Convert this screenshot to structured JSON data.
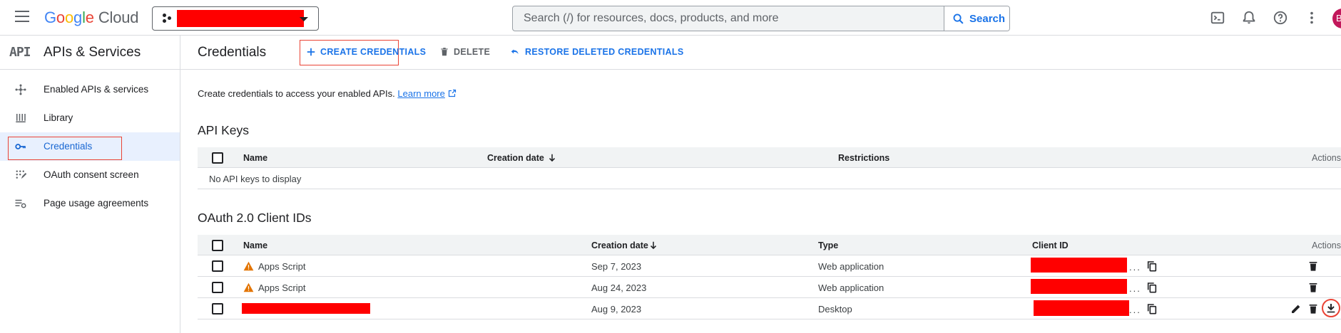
{
  "header": {
    "logo_google": "Google",
    "logo_cloud": "Cloud",
    "search_placeholder": "Search (/) for resources, docs, products, and more",
    "search_button": "Search",
    "avatar_letter": "B"
  },
  "sidebar": {
    "title": "APIs & Services",
    "logo_text": "API",
    "items": [
      {
        "label": "Enabled APIs & services",
        "icon": "hub-icon"
      },
      {
        "label": "Library",
        "icon": "library-icon"
      },
      {
        "label": "Credentials",
        "icon": "key-icon",
        "active": true
      },
      {
        "label": "OAuth consent screen",
        "icon": "consent-icon"
      },
      {
        "label": "Page usage agreements",
        "icon": "settings-list-icon"
      }
    ]
  },
  "main": {
    "title": "Credentials",
    "actions": {
      "create": "CREATE CREDENTIALS",
      "delete": "DELETE",
      "restore": "RESTORE DELETED CREDENTIALS"
    },
    "intro_text": "Create credentials to access your enabled APIs.",
    "learn_more": "Learn more",
    "api_keys": {
      "title": "API Keys",
      "columns": {
        "name": "Name",
        "creation_date": "Creation date",
        "restrictions": "Restrictions",
        "actions": "Actions"
      },
      "empty": "No API keys to display"
    },
    "oauth": {
      "title": "OAuth 2.0 Client IDs",
      "columns": {
        "name": "Name",
        "creation_date": "Creation date",
        "type": "Type",
        "client_id": "Client ID",
        "actions": "Actions"
      },
      "rows": [
        {
          "name": "Apps Script",
          "warning": true,
          "date": "Sep 7, 2023",
          "type": "Web application",
          "client_suffix": "..."
        },
        {
          "name": "Apps Script",
          "warning": true,
          "date": "Aug 24, 2023",
          "type": "Web application",
          "client_suffix": "..."
        },
        {
          "name": "",
          "redacted": true,
          "date": "Aug 9, 2023",
          "type": "Desktop",
          "client_suffix": "..."
        }
      ]
    }
  },
  "colors": {
    "accent": "#1a73e8",
    "highlight": "#ea4335",
    "redaction": "#ff0000",
    "warning": "#e37400"
  }
}
